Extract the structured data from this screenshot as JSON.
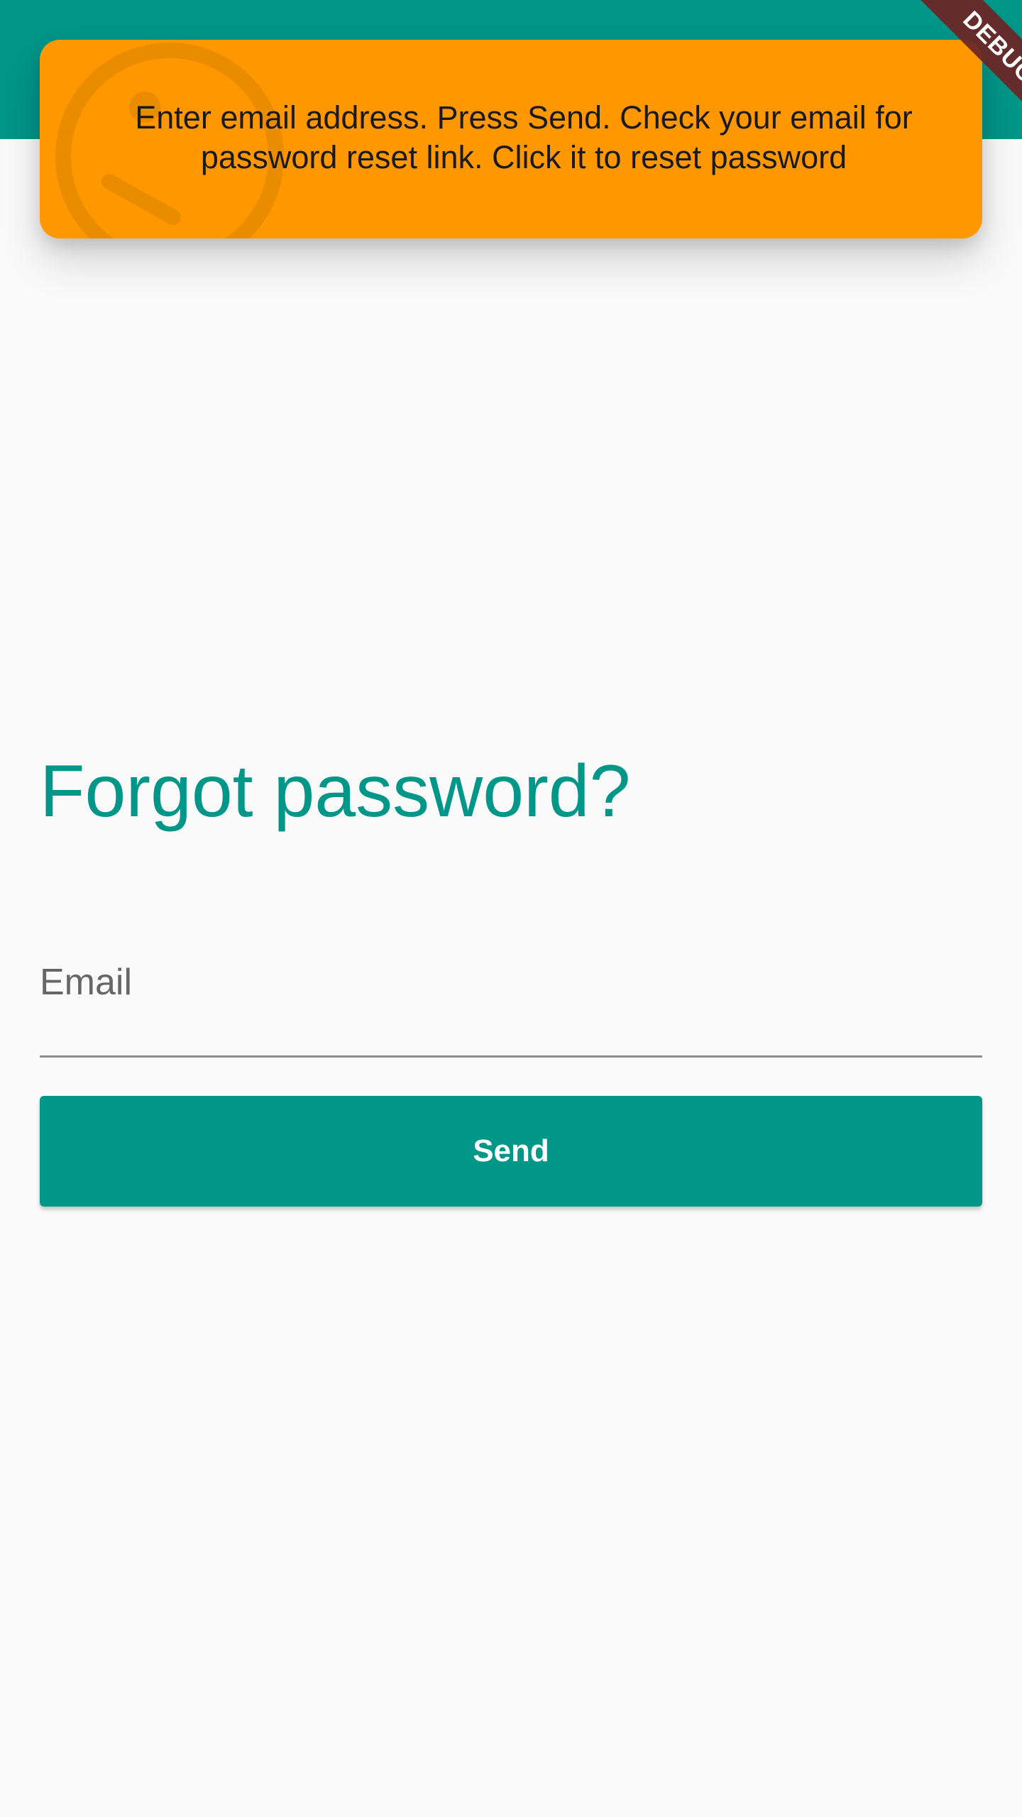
{
  "app_bar": {
    "color": "#009688"
  },
  "snackbar": {
    "color": "#FF9800",
    "icon": "info-icon",
    "message": "Enter email address. Press Send. Check your email for password reset link. Click it to reset password"
  },
  "debug_banner": {
    "label": "DEBUG"
  },
  "form": {
    "title": "Forgot password?",
    "email_placeholder": "Email",
    "send_label": "Send",
    "accent": "#009688"
  }
}
